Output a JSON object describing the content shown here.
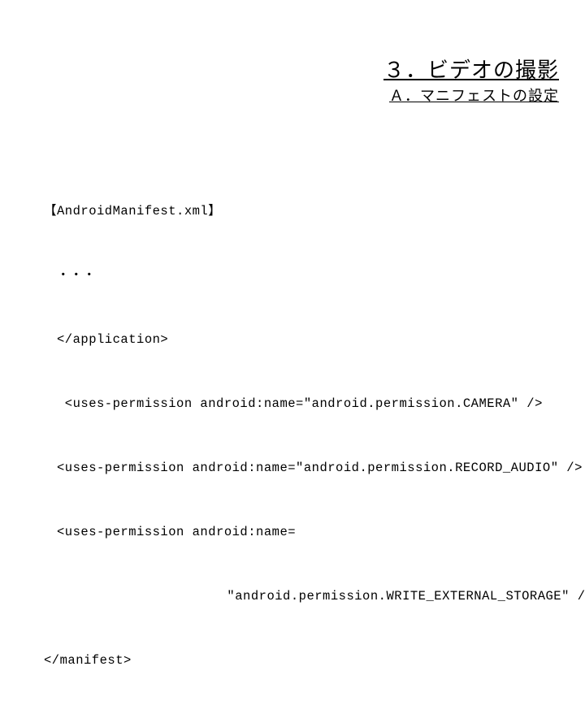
{
  "title": "３．ビデオの撮影",
  "subtitle": "Ａ．マニフェストの設定",
  "code": {
    "line0": "【AndroidManifest.xml】",
    "line1": "　・・・",
    "line2": "　</application>",
    "line3": "　 <uses-permission android:name=\"android.permission.CAMERA\" />",
    "line4": "　<uses-permission android:name=\"android.permission.RECORD_AUDIO\" />",
    "line5": "　<uses-permission android:name=",
    "line6": "                       \"android.permission.WRITE_EXTERNAL_STORAGE\" />",
    "line7": "</manifest>"
  }
}
